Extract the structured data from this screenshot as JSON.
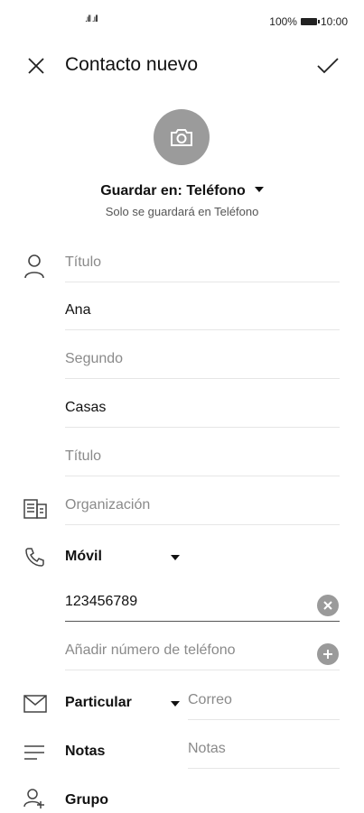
{
  "status_bar": {
    "signal": ".ıll .ıll",
    "battery_text": "100%",
    "time": "10:00"
  },
  "header": {
    "title": "Contacto nuevo"
  },
  "save": {
    "label": "Guardar en: Teléfono",
    "note": "Solo se guardará en Teléfono"
  },
  "fields": {
    "prefix": "Título",
    "first_name": "Ana",
    "middle_name": "Segundo",
    "last_name": "Casas",
    "suffix": "Título",
    "organization": "Organización"
  },
  "phone": {
    "type": "Móvil",
    "number": "123456789",
    "add_placeholder": "Añadir número de teléfono"
  },
  "email": {
    "type": "Particular",
    "placeholder": "Correo"
  },
  "notes": {
    "label": "Notas",
    "placeholder": "Notas"
  },
  "group": {
    "label": "Grupo"
  },
  "colors": {
    "accent_gray": "#9b9b9b",
    "text": "#111111",
    "placeholder": "#8a8a8a"
  }
}
